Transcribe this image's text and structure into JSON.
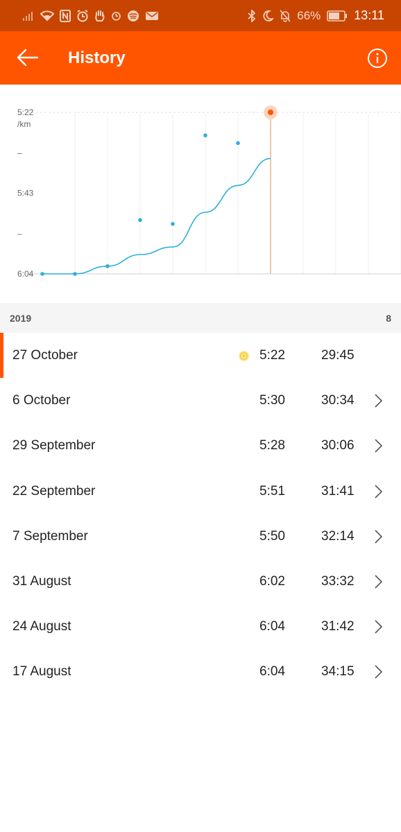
{
  "status_bar": {
    "battery": "66%",
    "time": "13:11",
    "icons_left": [
      "signal-icon",
      "wifi-icon",
      "nfc-icon",
      "alarm-icon",
      "hand-icon",
      "alarm-small-icon",
      "spotify-icon",
      "mail-icon"
    ],
    "icons_right": [
      "bluetooth-icon",
      "moon-icon",
      "mute-icon",
      "battery-icon"
    ]
  },
  "app_bar": {
    "title": "History",
    "background": "#ff5500"
  },
  "chart_data": {
    "type": "line",
    "ylabel_top": "5:22",
    "yunit": "/km",
    "y_tick_labels": [
      "5:22",
      "–",
      "5:43",
      "–",
      "6:04"
    ],
    "y_reversed": true,
    "points_pace": [
      {
        "date": "17 August",
        "pace": "6:04"
      },
      {
        "date": "24 August",
        "pace": "6:04"
      },
      {
        "date": "31 August",
        "pace": "6:02"
      },
      {
        "date": "7 September",
        "pace": "5:50"
      },
      {
        "date": "22 September",
        "pace": "5:51"
      },
      {
        "date": "29 September",
        "pace": "5:28"
      },
      {
        "date": "6 October",
        "pace": "5:30"
      },
      {
        "date": "27 October",
        "pace": "5:22"
      }
    ],
    "trend_pace": [
      "6:04",
      "6:04",
      "6:02",
      "5:59",
      "5:57",
      "5:48",
      "5:41",
      "5:34"
    ],
    "highlighted": "27 October",
    "grid": true,
    "colors": {
      "points": "#2ab0dd",
      "trend": "#2ab0dd",
      "highlight": "#ff5500",
      "marker_line": "#e8b48e"
    }
  },
  "year_header": {
    "year": "2019",
    "count": "8"
  },
  "runs": [
    {
      "date": "27 October",
      "pace": "5:22",
      "time": "29:45",
      "best": true
    },
    {
      "date": "6 October",
      "pace": "5:30",
      "time": "30:34",
      "best": false
    },
    {
      "date": "29 September",
      "pace": "5:28",
      "time": "30:06",
      "best": false
    },
    {
      "date": "22 September",
      "pace": "5:51",
      "time": "31:41",
      "best": false
    },
    {
      "date": "7 September",
      "pace": "5:50",
      "time": "32:14",
      "best": false
    },
    {
      "date": "31 August",
      "pace": "6:02",
      "time": "33:32",
      "best": false
    },
    {
      "date": "24 August",
      "pace": "6:04",
      "time": "31:42",
      "best": false
    },
    {
      "date": "17 August",
      "pace": "6:04",
      "time": "34:15",
      "best": false
    }
  ]
}
